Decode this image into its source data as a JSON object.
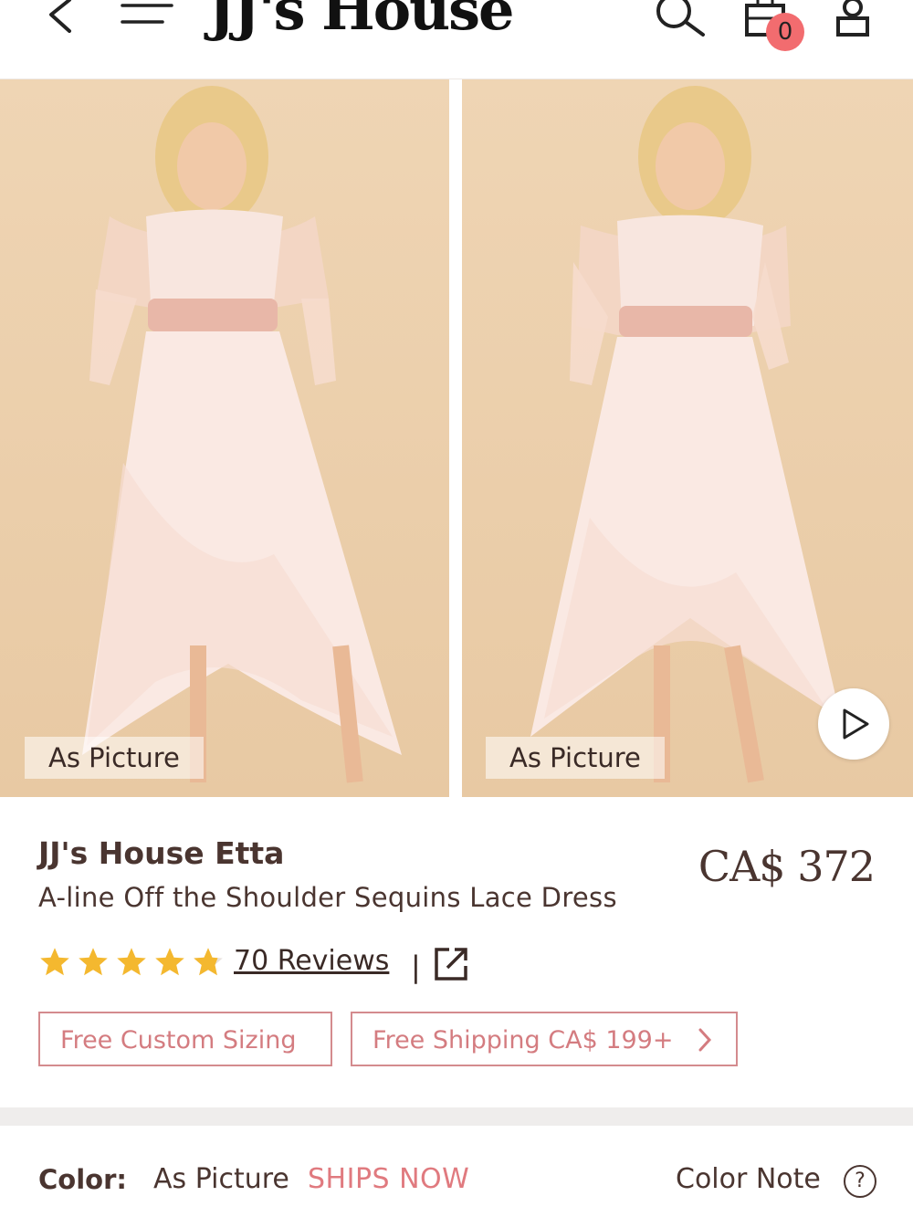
{
  "header": {
    "logo": "JJ's House",
    "cart_count": "0",
    "icons": [
      "back-icon",
      "menu-icon",
      "search-icon",
      "cart-icon",
      "account-icon"
    ]
  },
  "gallery": {
    "images": [
      {
        "tag": "As Picture"
      },
      {
        "tag": "As Picture"
      }
    ],
    "video_icon": "play-icon"
  },
  "product": {
    "brand": "JJ's House Etta",
    "subtitle": "A-line Off the Shoulder Sequins Lace Dress",
    "price": "CA$ 372",
    "rating": 4.8,
    "reviews": "70 Reviews",
    "divider": "|",
    "badges": {
      "custom_sizing": "Free Custom Sizing",
      "free_shipping": "Free Shipping CA$ 199+"
    }
  },
  "color": {
    "label": "Color:",
    "value": "As Picture",
    "ships": "SHIPS NOW",
    "note": "Color Note",
    "help_symbol": "?"
  },
  "colors": {
    "accent": "#d47c80",
    "star": "#f4b82f",
    "badge": "#f26c6f",
    "text": "#4a3530"
  }
}
